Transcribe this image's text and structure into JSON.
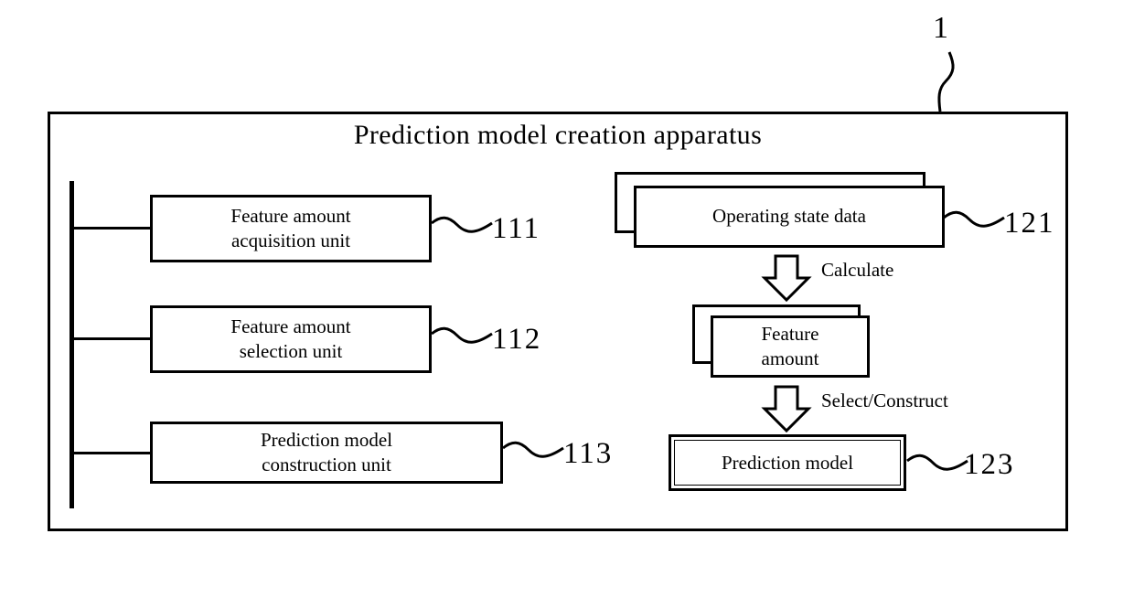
{
  "figure": {
    "reference_numeral": "1",
    "apparatus_title": "Prediction model creation apparatus"
  },
  "processing_units": [
    {
      "id": "111",
      "name": "feature-amount-acquisition-unit",
      "line1": "Feature amount",
      "line2": "acquisition unit",
      "reference_numeral": "111"
    },
    {
      "id": "112",
      "name": "feature-amount-selection-unit",
      "line1": "Feature amount",
      "line2": "selection unit",
      "reference_numeral": "112"
    },
    {
      "id": "113",
      "name": "prediction-model-construction-unit",
      "line1": "Prediction model",
      "line2": "construction unit",
      "reference_numeral": "113"
    }
  ],
  "data_objects": [
    {
      "id": "121",
      "name": "operating-state-data",
      "line1": "Operating state data",
      "line2": "",
      "reference_numeral": "121",
      "stacked": true
    },
    {
      "id": "122",
      "name": "feature-amount",
      "line1": "Feature",
      "line2": "amount",
      "reference_numeral": "",
      "stacked": true
    },
    {
      "id": "123",
      "name": "prediction-model",
      "line1": "Prediction model",
      "line2": "",
      "reference_numeral": "123",
      "stacked": false
    }
  ],
  "flow_arrows": [
    {
      "id": "calculate",
      "caption": "Calculate",
      "from": "121",
      "to": "122"
    },
    {
      "id": "select-construct",
      "caption": "Select/Construct",
      "from": "122",
      "to": "123"
    }
  ],
  "colors": {
    "line": "#000000",
    "background": "#ffffff"
  }
}
